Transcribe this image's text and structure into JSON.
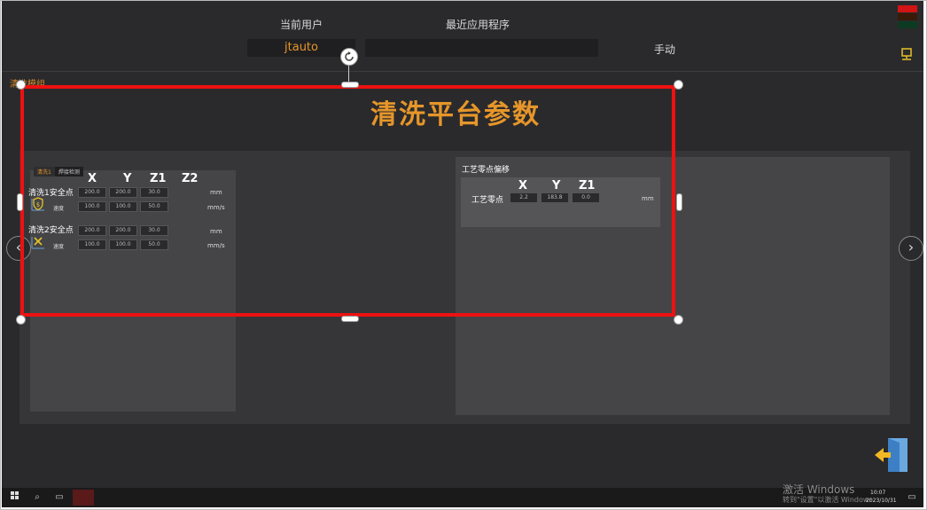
{
  "header": {
    "current_user_label": "当前用户",
    "current_user_value": "jtauto",
    "recent_app_label": "最近应用程序",
    "recent_app_value": "",
    "mode": "手动"
  },
  "status_lights": [
    "#d11414",
    "#3a1a08",
    "#0c3a22"
  ],
  "section_label": "清洗模组",
  "big_title": "清洗平台参数",
  "tabs": [
    {
      "label": "清洗1",
      "active": true
    },
    {
      "label": "焊接检测",
      "active": false
    }
  ],
  "left_panel": {
    "columns": [
      "X",
      "Y",
      "Z1",
      "Z2"
    ],
    "groups": [
      {
        "label": "清洗1安全点",
        "icon": "shield-dollar-icon",
        "position_values": [
          "200.0",
          "200.0",
          "30.0"
        ],
        "position_unit": "mm",
        "speed_label": "速度",
        "speed_values": [
          "100.0",
          "100.0",
          "50.0"
        ],
        "speed_unit": "mm/s"
      },
      {
        "label": "清洗2安全点",
        "icon": "tools-icon",
        "position_values": [
          "200.0",
          "200.0",
          "30.0"
        ],
        "position_unit": "mm",
        "speed_label": "速度",
        "speed_values": [
          "100.0",
          "100.0",
          "50.0"
        ],
        "speed_unit": "mm/s"
      }
    ]
  },
  "right_panel": {
    "title": "工艺零点偏移",
    "columns": [
      "X",
      "Y",
      "Z1"
    ],
    "row_label": "工艺零点",
    "values": [
      "2.2",
      "183.8",
      "0.0"
    ],
    "unit": "mm"
  },
  "nav": {
    "prev_icon": "chevron-left-icon",
    "next_icon": "chevron-right-icon"
  },
  "exit_icon": "exit-door-icon",
  "taskbar": {
    "watermark_line1": "激活 Windows",
    "watermark_line2": "转到\"设置\"以激活 Windows。",
    "time": "10:07",
    "date": "2023/10/31"
  }
}
